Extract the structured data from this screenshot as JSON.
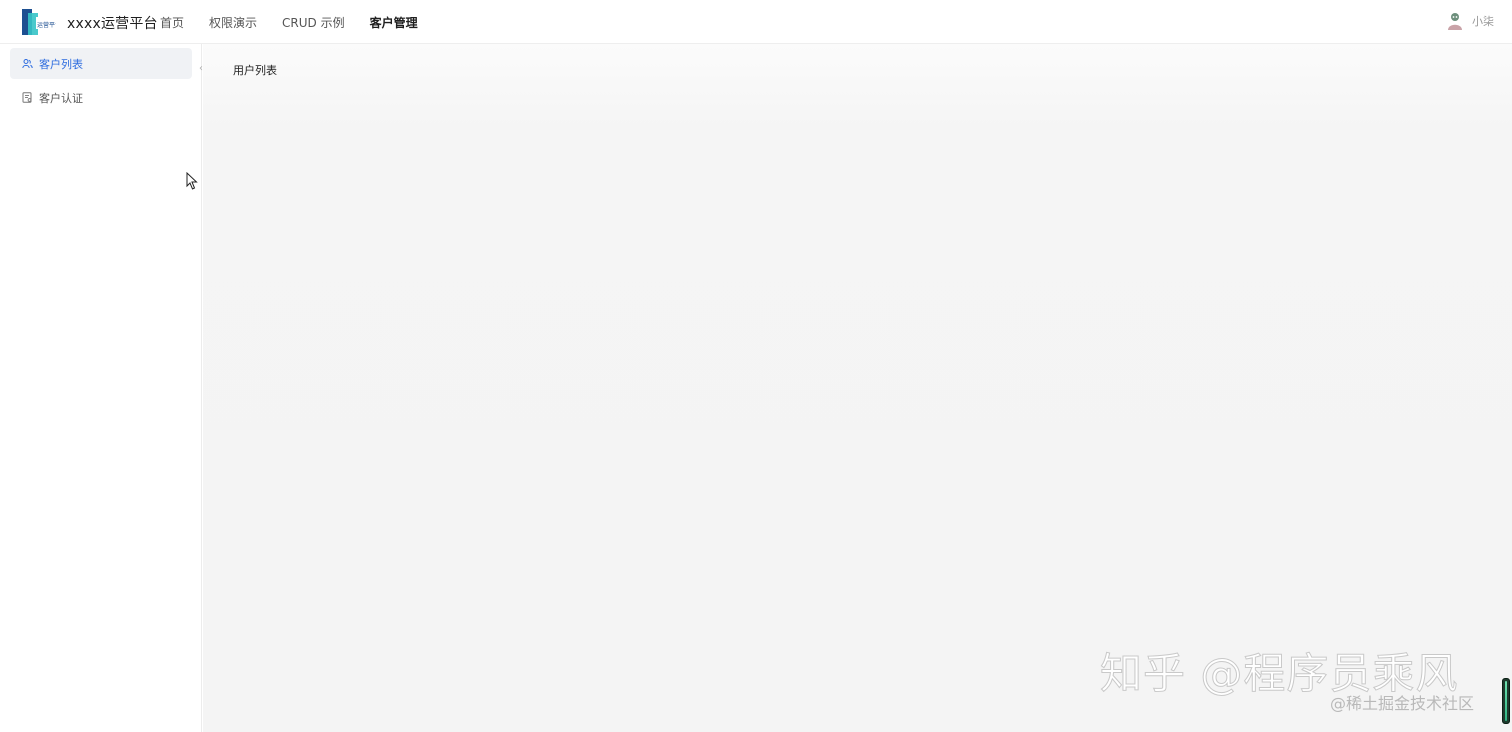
{
  "header": {
    "app_title": "xxxx运营平台",
    "logo_text": "运营平台",
    "nav": [
      {
        "label": "首页",
        "active": false
      },
      {
        "label": "权限演示",
        "active": false
      },
      {
        "label": "CRUD 示例",
        "active": false
      },
      {
        "label": "客户管理",
        "active": true
      }
    ],
    "user_name": "小柒"
  },
  "sidebar": {
    "items": [
      {
        "label": "客户列表",
        "icon": "users-icon",
        "active": true
      },
      {
        "label": "客户认证",
        "icon": "document-icon",
        "active": false
      }
    ],
    "collapse_glyph": "‹"
  },
  "main": {
    "page_title": "用户列表"
  },
  "watermark": {
    "big": "知乎 @程序员乘风",
    "small": "@稀土掘金技术社区"
  },
  "colors": {
    "accent": "#2d6cdf",
    "active_bg": "#f0f2f5",
    "main_bg": "#f4f4f4"
  }
}
